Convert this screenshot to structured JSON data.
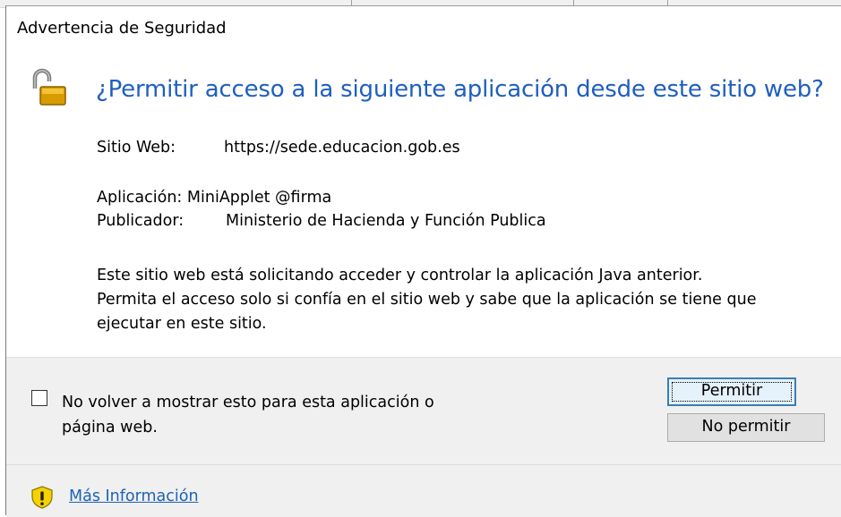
{
  "dialog": {
    "title": "Advertencia de Seguridad",
    "headline": "¿Permitir acceso a la siguiente aplicación desde este sitio web?",
    "site_label": "Sitio Web:",
    "site_value": "https://sede.educacion.gob.es",
    "app_label": "Aplicación:",
    "app_value": "MiniApplet @firma",
    "publisher_label": "Publicador:",
    "publisher_value": "Ministerio de Hacienda y Función Publica",
    "description_line1": "Este sitio web está solicitando acceder y controlar la aplicación Java anterior.",
    "description_line2": "Permita el acceso solo si confía en el sitio web y sabe que la aplicación se tiene que",
    "description_line3": "ejecutar en este sitio.",
    "checkbox_label_line1": "No volver a mostrar esto para esta aplicación o",
    "checkbox_label_line2": "página web.",
    "checkbox_checked": false,
    "allow_button": "Permitir",
    "deny_button": "No permitir",
    "more_info_link": "Más Información"
  },
  "icons": {
    "lock": "unlocked-padlock-icon",
    "warning": "shield-warning-icon"
  },
  "colors": {
    "headline": "#1f5fbf",
    "link": "#1e63b4",
    "bottom_panel": "#f0f0f0"
  }
}
